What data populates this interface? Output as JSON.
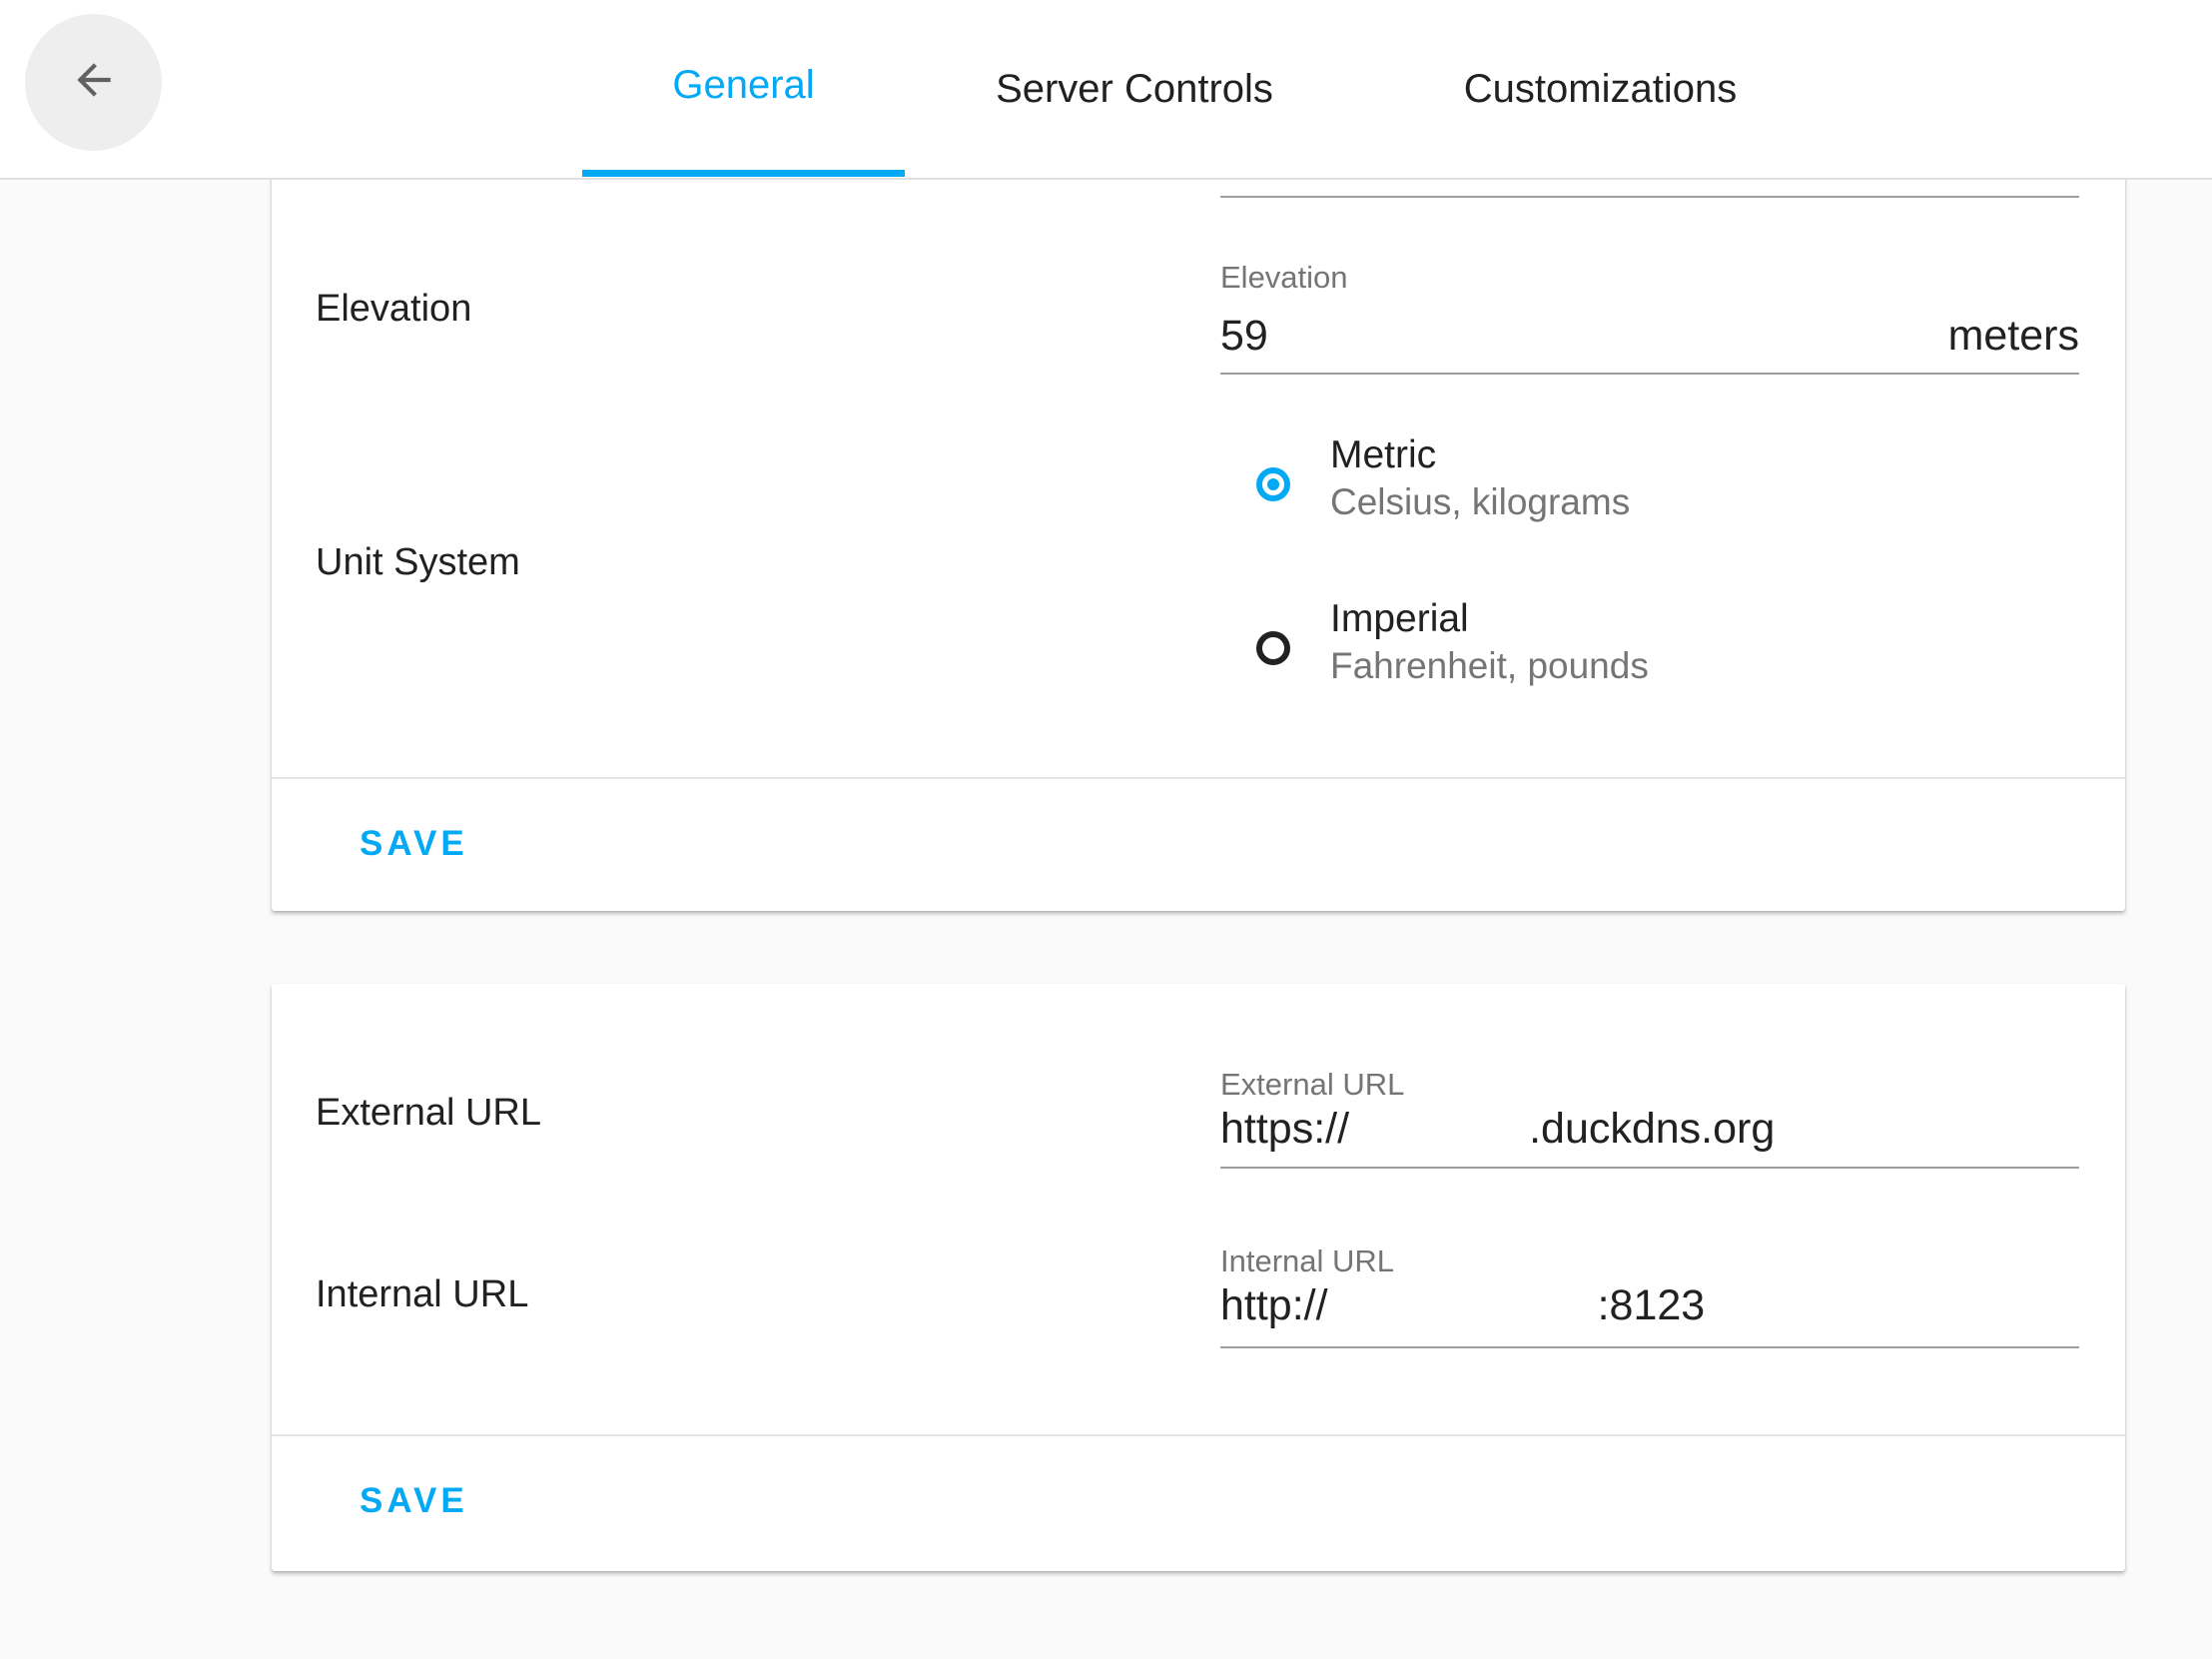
{
  "header": {
    "back_icon": "arrow-left-icon",
    "tabs": [
      {
        "label": "General",
        "active": true
      },
      {
        "label": "Server Controls",
        "active": false
      },
      {
        "label": "Customizations",
        "active": false
      }
    ]
  },
  "location_card": {
    "elevation": {
      "row_label": "Elevation",
      "field_label": "Elevation",
      "value": "59",
      "unit": "meters"
    },
    "unit_system": {
      "row_label": "Unit System",
      "options": [
        {
          "title": "Metric",
          "subtitle": "Celsius, kilograms",
          "checked": true
        },
        {
          "title": "Imperial",
          "subtitle": "Fahrenheit, pounds",
          "checked": false
        }
      ]
    },
    "save_label": "SAVE"
  },
  "url_card": {
    "external": {
      "row_label": "External URL",
      "field_label": "External URL",
      "value_prefix": "https://",
      "value_suffix": ".duckdns.org"
    },
    "internal": {
      "row_label": "Internal URL",
      "field_label": "Internal URL",
      "value_prefix": "http://",
      "value_suffix": ":8123"
    },
    "save_label": "SAVE"
  },
  "colors": {
    "accent": "#03a9f4",
    "text_primary": "#212121",
    "text_secondary": "#757575",
    "background": "#fafafa"
  }
}
